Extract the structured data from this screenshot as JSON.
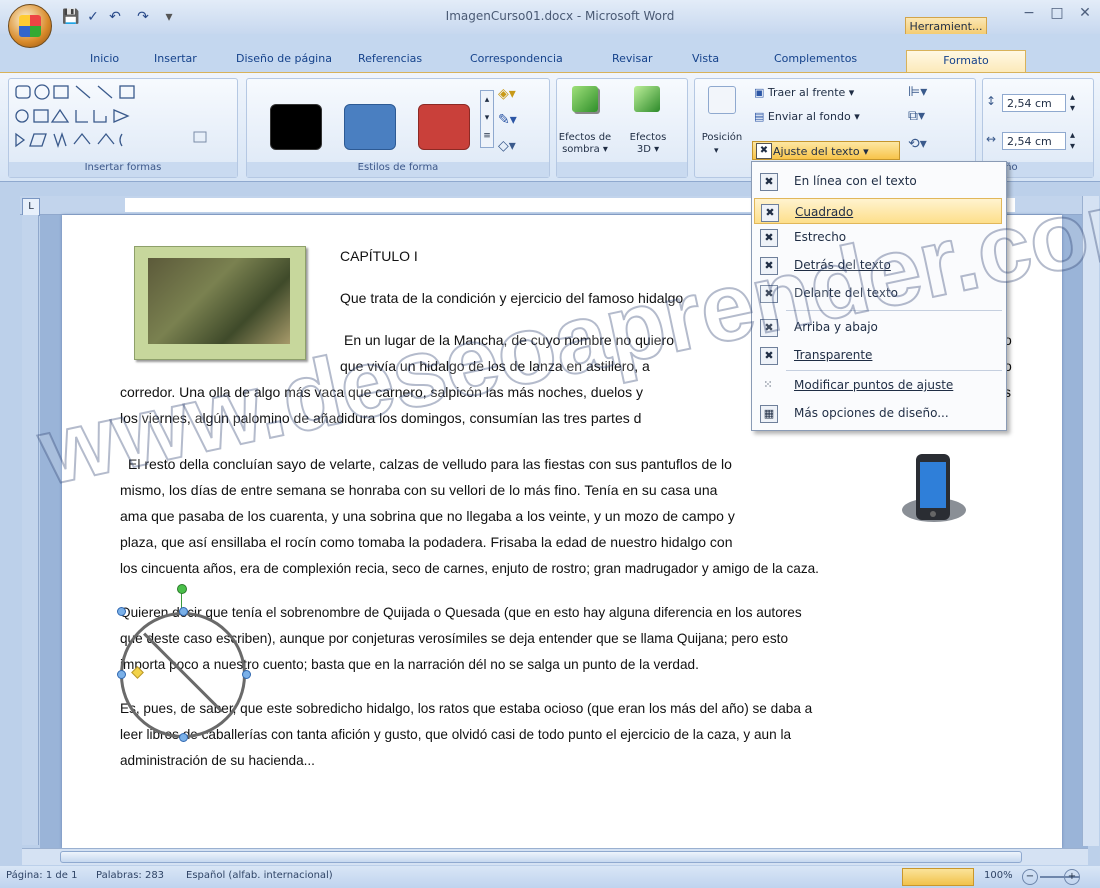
{
  "window": {
    "title": "ImagenCurso01.docx - Microsoft Word",
    "contextual_tab": "Herramient...",
    "min": "−",
    "max": "□",
    "close": "✕"
  },
  "tabs": [
    "Inicio",
    "Insertar",
    "Diseño de página",
    "Referencias",
    "Correspondencia",
    "Revisar",
    "Vista",
    "Complementos",
    "Formato"
  ],
  "ribbon": {
    "group_insert_shapes": "Insertar formas",
    "group_shape_styles": "Estilos de forma",
    "group_size_partial": "año",
    "shadow_effects": [
      "Efectos de",
      "sombra ▾"
    ],
    "effects_3d": [
      "Efectos",
      "3D ▾"
    ],
    "position": "Posición",
    "bring_front": "Traer al frente ▾",
    "send_back": "Enviar al fondo ▾",
    "wrap_text": "Ajuste del texto ▾",
    "height": "2,54 cm",
    "width": "2,54 cm"
  },
  "wrap_menu": {
    "items": [
      {
        "label": "En línea con el texto"
      },
      {
        "label": "Cuadrado"
      },
      {
        "label": "Estrecho"
      },
      {
        "label": "Detrás del texto"
      },
      {
        "label": "Delante del texto"
      },
      {
        "label": "Arriba y abajo"
      },
      {
        "label": "Transparente"
      },
      {
        "label": "Modificar puntos de ajuste"
      },
      {
        "label": "Más opciones de diseño..."
      }
    ]
  },
  "document": {
    "chapter": "CAPÍTULO I",
    "subtitle": "Que trata de la condición y ejercicio del famoso hidalgo",
    "p1_line1": "En un lugar de la Mancha, de cuyo nombre no quiero",
    "p1_line1_end": "o",
    "p1_line2": "que vivía un hidalgo de los de lanza en astillero, a",
    "p1_line2_end": "o",
    "p1_line3": "corredor. Una olla de algo más vaca que carnero, salpicón las más noches, duelos y",
    "p1_line3_end": "s",
    "p1_line4": "los viernes, algún palomino de añadidura los domingos, consumían las tres partes d",
    "p2_line1": "El resto della concluían sayo de velarte, calzas de velludo para las fiestas con sus pantuflos de lo",
    "p2_line2": "mismo, los días de entre semana se honraba con su vellori de lo más fino. Tenía en su casa una",
    "p2_line3": "ama que pasaba de los cuarenta, y una sobrina que no llegaba a los veinte, y un mozo de campo y",
    "p2_line4": "plaza, que así ensillaba el rocín como tomaba la podadera. Frisaba la edad de nuestro hidalgo con",
    "p2_line5": "los cincuenta años, era de complexión recia, seco de carnes, enjuto de rostro; gran madrugador y amigo de la caza.",
    "p3_line1": "Quieren decir que tenía el sobrenombre de Quijada o Quesada (que en esto hay alguna diferencia en los autores",
    "p3_line2": "que deste caso escriben), aunque por conjeturas verosímiles se deja entender que se llama Quijana; pero esto",
    "p3_line3": "importa poco a nuestro cuento; basta que en la narración dél no se salga un punto de la verdad.",
    "p4_line1": "Es, pues, de saber, que este sobredicho hidalgo, los ratos que estaba ocioso (que eran los más del año) se daba a",
    "p4_line2": "leer libros de caballerías con tanta afición y gusto, que olvidó casi de todo punto el ejercicio de la caza, y aun la",
    "p4_line3": "administración de su hacienda..."
  },
  "watermark": "www.deseoaprender.com",
  "status": {
    "page": "Página: 1 de 1",
    "words": "Palabras: 283",
    "language": "Español (alfab. internacional)",
    "zoom": "100%"
  }
}
